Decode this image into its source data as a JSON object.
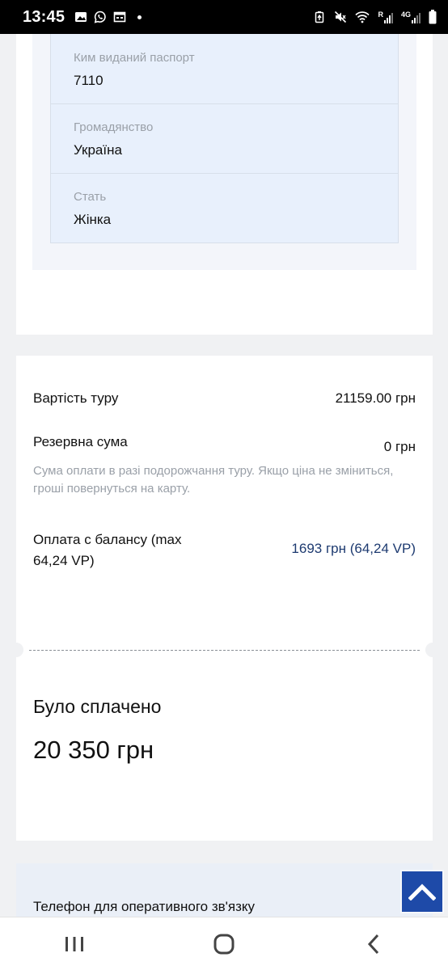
{
  "status_bar": {
    "time": "13:45",
    "left_icons": [
      "image-icon",
      "viber-icon",
      "calendar-icon",
      "dot-icon"
    ],
    "right_icons": [
      "battery-saver-icon",
      "mute-icon",
      "wifi-icon",
      "signal-r-icon",
      "signal-4g-icon",
      "battery-icon"
    ],
    "network_label": "4G",
    "roaming_label": "R"
  },
  "passport": {
    "rows": [
      {
        "label": "Ким виданий паспорт",
        "value": "7110"
      },
      {
        "label": "Громадянство",
        "value": "Україна"
      },
      {
        "label": "Стать",
        "value": "Жінка"
      }
    ]
  },
  "cost": {
    "tour_cost_label": "Вартість туру",
    "tour_cost_value": "21159.00 грн",
    "reserve_label": "Резервна сума",
    "reserve_value": "0 грн",
    "reserve_note": "Сума оплати в разі подорожчання туру. Якщо ціна не зміниться, гроші повернуться на карту.",
    "balance_label": "Оплата с балансу (max 64,24 VP)",
    "balance_value": "1693 грн (64,24 VP)"
  },
  "paid": {
    "title": "Було сплачено",
    "amount": "20 350 грн"
  },
  "phone": {
    "label": "Телефон для оперативного зв'язку"
  },
  "colors": {
    "accent": "#1e4aa8",
    "balance_value": "#1d3a70",
    "passport_bg": "#e8f0fc"
  },
  "nav": {
    "icons": [
      "recent-apps-icon",
      "home-icon",
      "back-icon"
    ]
  }
}
